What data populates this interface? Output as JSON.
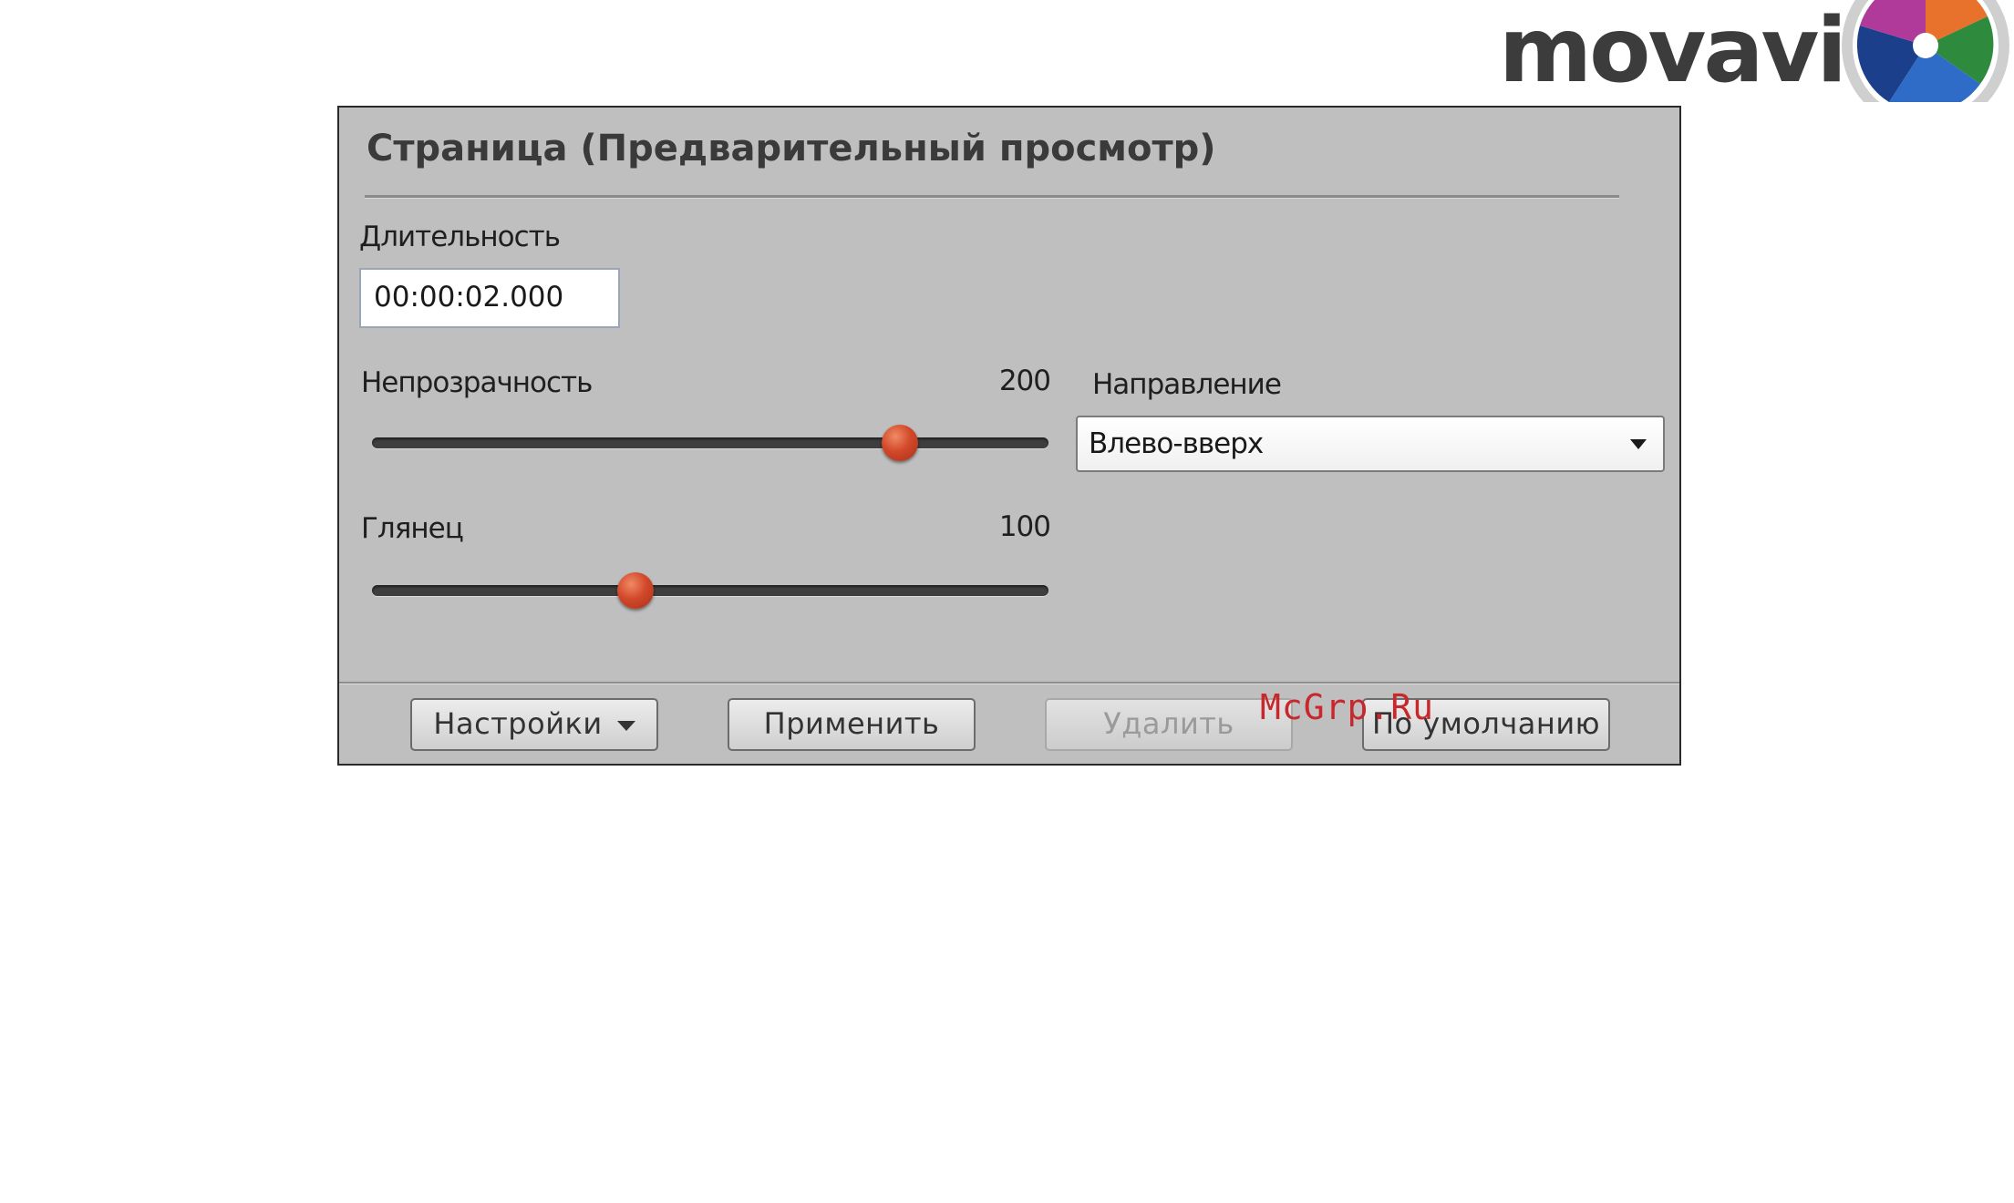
{
  "logo": {
    "text": "movavi",
    "icon": "movavi-pinwheel-icon"
  },
  "panel": {
    "title": "Страница (Предварительный просмотр)",
    "duration": {
      "label": "Длительность",
      "value": "00:00:02.000"
    },
    "opacity": {
      "label": "Непрозрачность",
      "value": "200",
      "level": 0.78
    },
    "gloss": {
      "label": "Глянец",
      "value": "100",
      "level": 0.39
    },
    "direction": {
      "label": "Направление",
      "selected": "Влево-вверх"
    }
  },
  "buttons": {
    "settings": "Настройки",
    "apply": "Применить",
    "delete": "Удалить",
    "default": "По умолчанию"
  },
  "watermark": "McGrp.Ru",
  "colors": {
    "accent": "#d2492a",
    "panel_bg": "#bfbfbf",
    "watermark": "#c8282c"
  }
}
